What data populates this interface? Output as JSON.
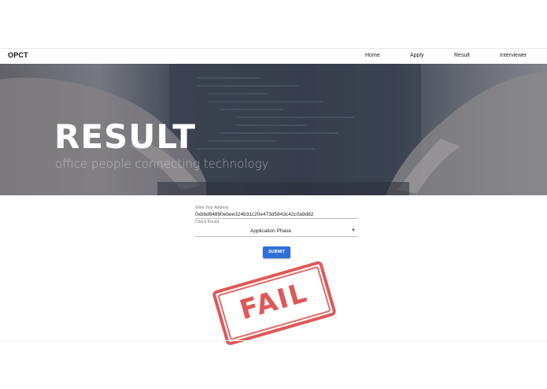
{
  "navbar": {
    "brand": "OPCT",
    "links": [
      "Home",
      "Apply",
      "Result",
      "Interviewer"
    ]
  },
  "hero": {
    "title": "RESULT",
    "subtitle": "office people connecting technology"
  },
  "form": {
    "address_label": "Write Your Address",
    "address_value": "0xbbd64890ebee324b31c20e473d5843c42c0a9d82",
    "round_label": "Check Round",
    "round_value": "Application Phase",
    "submit_label": "SUBMIT"
  },
  "result": {
    "stamp_text": "FAIL"
  },
  "colors": {
    "accent": "#2f6fd6",
    "stamp": "#d93b3b"
  }
}
